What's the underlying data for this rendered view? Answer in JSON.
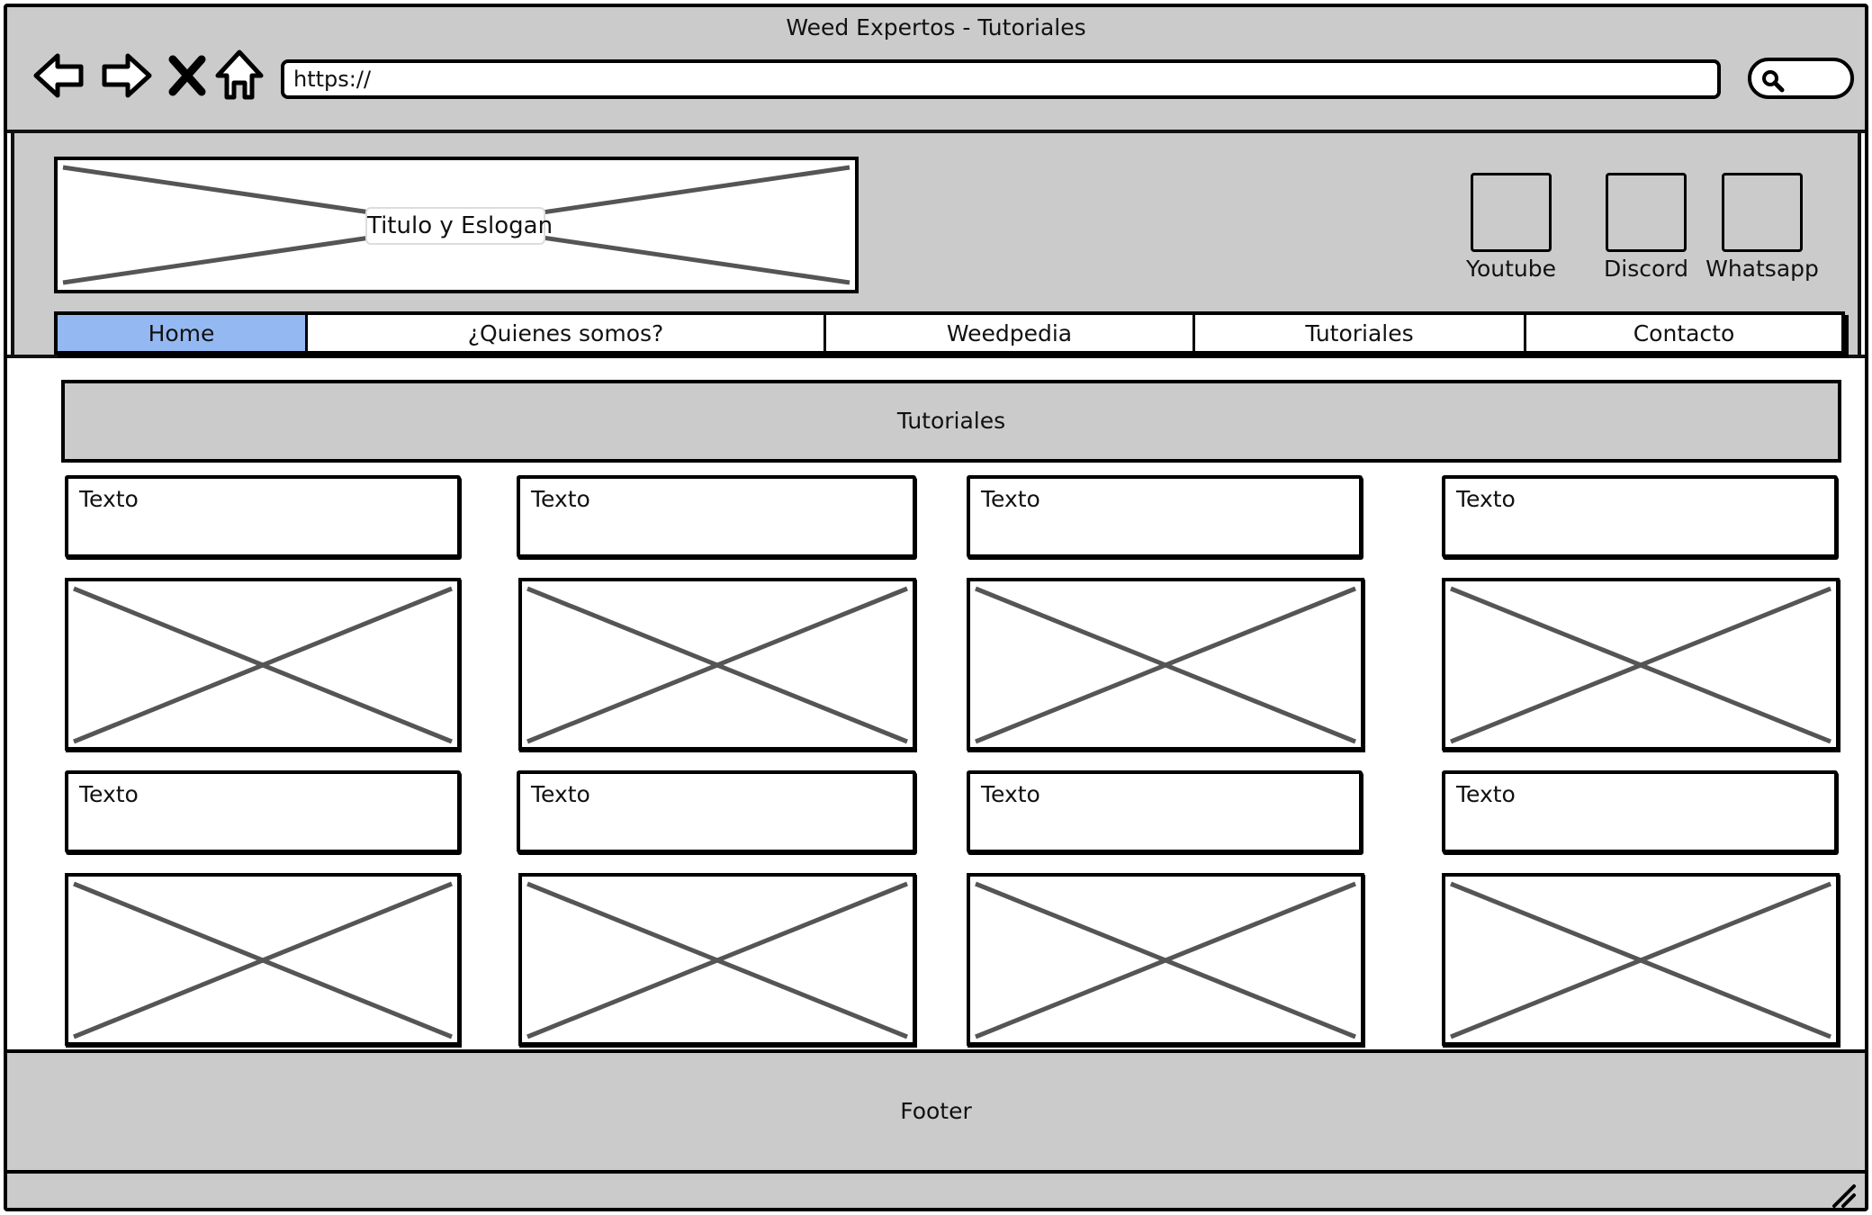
{
  "browser": {
    "title": "Weed Expertos - Tutoriales",
    "url": "https://",
    "nav_icons": [
      "back-arrow-icon",
      "forward-arrow-icon",
      "stop-x-icon",
      "home-icon"
    ],
    "search_icon": "search-icon"
  },
  "header": {
    "logo_label": "Titulo y Eslogan",
    "social": [
      {
        "label": "Youtube"
      },
      {
        "label": "Discord"
      },
      {
        "label": "Whatsapp"
      }
    ]
  },
  "menu": {
    "items": [
      {
        "label": "Home",
        "active": true
      },
      {
        "label": "¿Quienes somos?"
      },
      {
        "label": "Weedpedia"
      },
      {
        "label": "Tutoriales"
      },
      {
        "label": "Contacto"
      }
    ]
  },
  "section": {
    "title": "Tutoriales"
  },
  "cards": {
    "row1": [
      {
        "text": "Texto"
      },
      {
        "text": "Texto"
      },
      {
        "text": "Texto"
      },
      {
        "text": "Texto"
      }
    ],
    "row2": [
      {
        "text": "Texto"
      },
      {
        "text": "Texto"
      },
      {
        "text": "Texto"
      },
      {
        "text": "Texto"
      }
    ]
  },
  "footer": {
    "label": "Footer"
  },
  "colors": {
    "chrome": "#cbcbcb",
    "active_tab": "#94b9f2",
    "placeholder_x": "#555555"
  }
}
